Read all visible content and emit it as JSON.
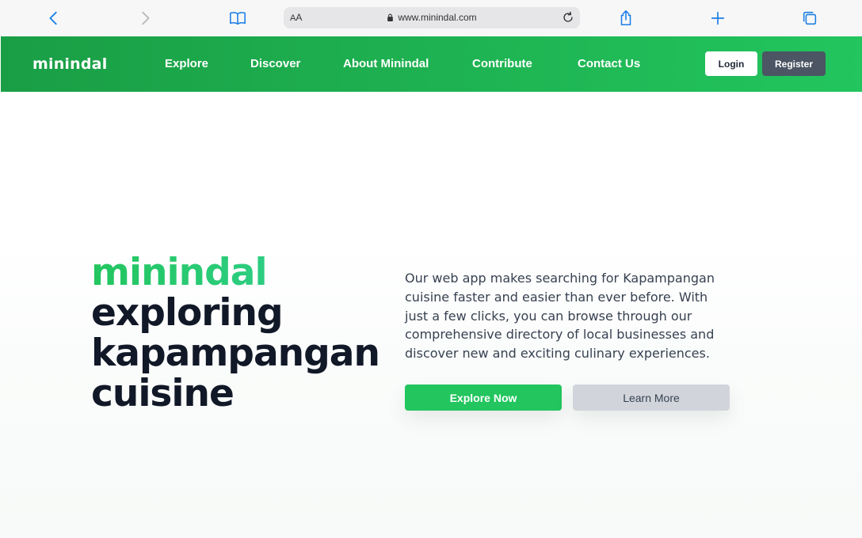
{
  "browser": {
    "address_aa_small": "A",
    "address_aa_big": "A",
    "url": "www.minindal.com",
    "icons": [
      "chevron-left-icon",
      "chevron-right-icon",
      "book-icon",
      "lock-icon",
      "reload-icon",
      "share-icon",
      "plus-icon",
      "tabs-icon"
    ]
  },
  "nav": {
    "logo": "minindal",
    "links": [
      "Explore",
      "Discover",
      "About Minindal",
      "Contribute",
      "Contact Us"
    ],
    "login_label": "Login",
    "register_label": "Register",
    "gradient_start": "#1a9e45",
    "gradient_end": "#22c55e"
  },
  "hero": {
    "brand": "minindal",
    "line1": "exploring",
    "line2": "kapampangan",
    "line3": "cuisine",
    "description": "Our web app makes searching for Kapampangan cuisine faster and easier than ever before. With just a few clicks, you can browse through our comprehensive directory of local businesses and discover new and exciting culinary experiences.",
    "explore_label": "Explore Now",
    "learn_label": "Learn More",
    "accent": "#22c55e"
  }
}
